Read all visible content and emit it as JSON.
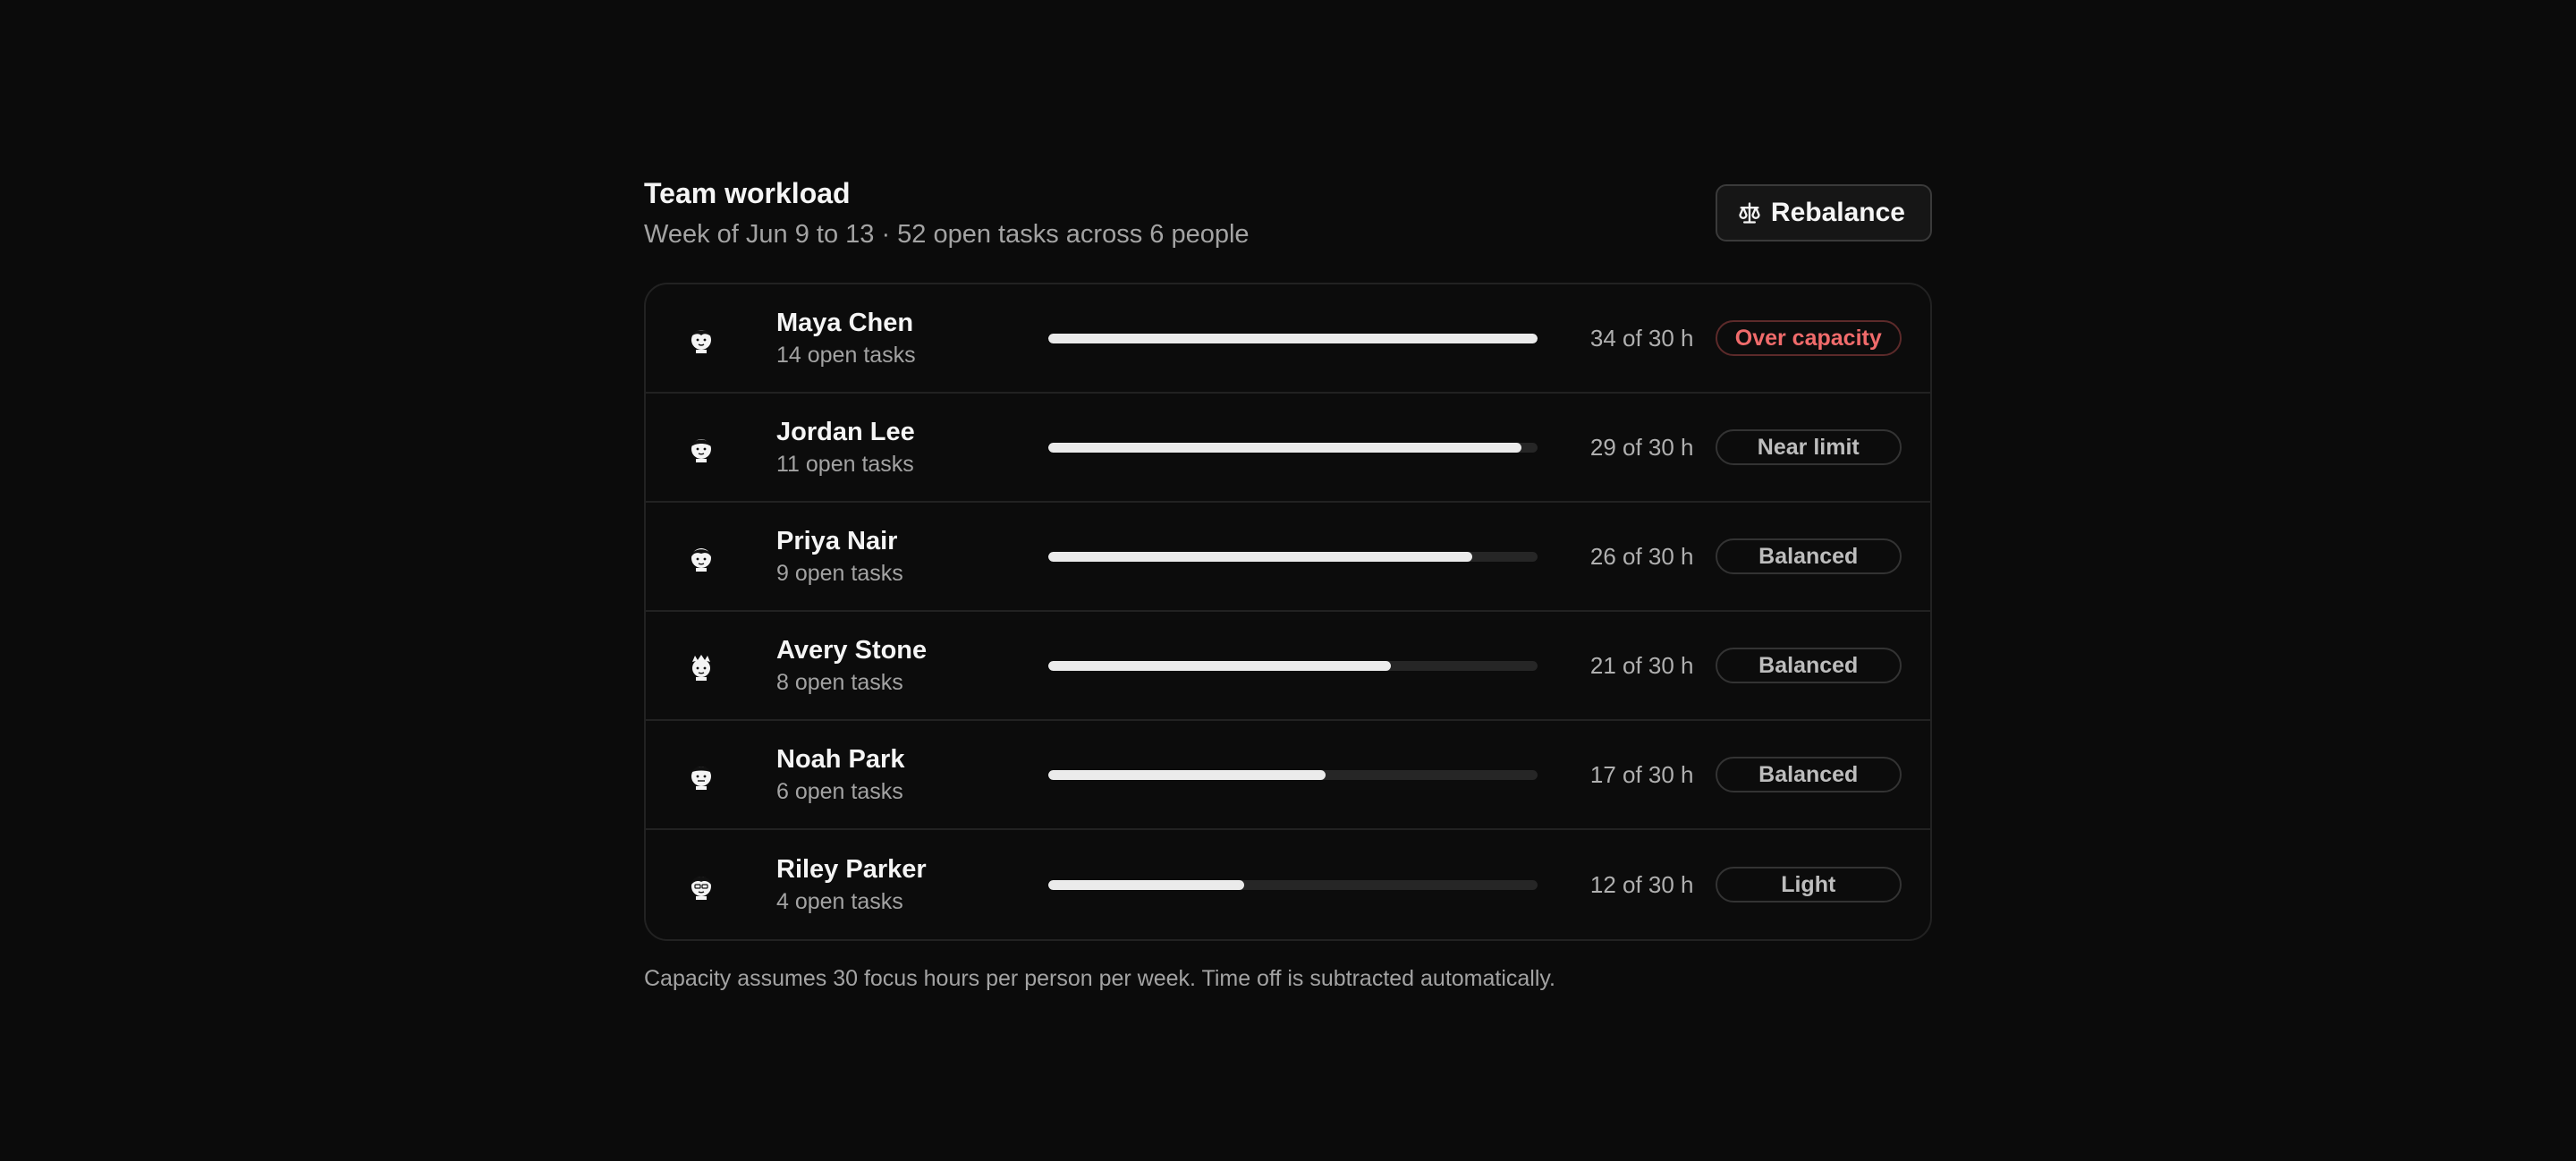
{
  "header": {
    "title": "Team workload",
    "subtitle": "Week of Jun 9 to 13 · 52 open tasks across 6 people",
    "rebalance_label": "Rebalance",
    "rebalance_icon": "scale-icon"
  },
  "people": [
    {
      "name": "Maya Chen",
      "tasks": "14 open tasks",
      "hours": "34 of 30 h",
      "load_fraction": 1.0,
      "status": "Over capacity",
      "status_kind": "over"
    },
    {
      "name": "Jordan Lee",
      "tasks": "11 open tasks",
      "hours": "29 of 30 h",
      "load_fraction": 0.967,
      "status": "Near limit",
      "status_kind": "normal"
    },
    {
      "name": "Priya Nair",
      "tasks": "9 open tasks",
      "hours": "26 of 30 h",
      "load_fraction": 0.867,
      "status": "Balanced",
      "status_kind": "normal"
    },
    {
      "name": "Avery Stone",
      "tasks": "8 open tasks",
      "hours": "21 of 30 h",
      "load_fraction": 0.7,
      "status": "Balanced",
      "status_kind": "normal"
    },
    {
      "name": "Noah Park",
      "tasks": "6 open tasks",
      "hours": "17 of 30 h",
      "load_fraction": 0.567,
      "status": "Balanced",
      "status_kind": "normal"
    },
    {
      "name": "Riley Parker",
      "tasks": "4 open tasks",
      "hours": "12 of 30 h",
      "load_fraction": 0.4,
      "status": "Light",
      "status_kind": "normal"
    }
  ],
  "footnote": "Capacity assumes 30 focus hours per person per week. Time off is subtracted automatically.",
  "colors": {
    "background": "#0b0b0b",
    "bar_fill": "#ebebeb",
    "bar_track": "#262626",
    "over_capacity": "#f06b6b"
  }
}
